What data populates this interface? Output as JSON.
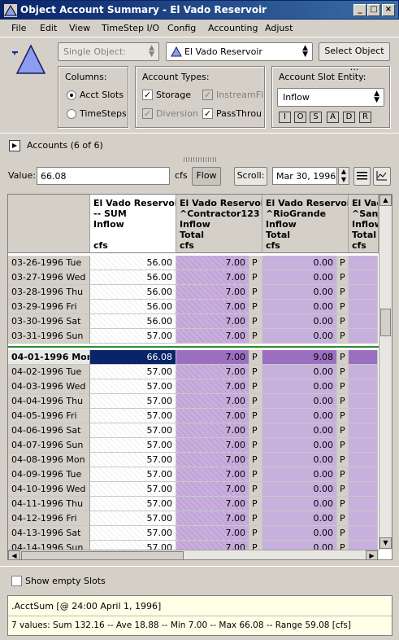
{
  "window": {
    "title": "Object Account Summary - El Vado Reservoir",
    "min": "_",
    "max": "□",
    "close": "×"
  },
  "menu": [
    "File",
    "Edit",
    "View",
    "TimeStep I/O",
    "Config",
    "Accounting",
    "Adjust"
  ],
  "toolbar": {
    "object_mode": "Single Object:",
    "object_name": "El Vado Reservoir",
    "select_object": "Select Object ..."
  },
  "columns_group": {
    "title": "Columns:",
    "options": [
      "Acct Slots",
      "TimeSteps"
    ],
    "selected": "Acct Slots"
  },
  "account_types": {
    "title": "Account Types:",
    "items": [
      {
        "label": "Storage",
        "checked": true,
        "enabled": true
      },
      {
        "label": "InstreamFl",
        "checked": true,
        "enabled": false
      },
      {
        "label": "Diversion",
        "checked": true,
        "enabled": false
      },
      {
        "label": "PassThrou",
        "checked": true,
        "enabled": true
      }
    ]
  },
  "entity": {
    "title": "Account Slot Entity:",
    "value": "Inflow",
    "buttons": [
      "I",
      "O",
      "S",
      "A",
      "D",
      "R"
    ]
  },
  "accounts_header": "Accounts (6 of 6)",
  "value_bar": {
    "label": "Value:",
    "value": "66.08",
    "unit": "cfs",
    "type": "Flow",
    "scroll_label": "Scroll:",
    "date": "Mar 30, 1996"
  },
  "grid": {
    "columns": [
      "El Vado Reservoir\n-- SUM\nInflow\n\ncfs",
      "El Vado Reservoir\n^Contractor123\nInflow\nTotal\ncfs",
      "El Vado Reservoir\n^RioGrande\nInflow\nTotal\ncfs",
      "El Vado Reservoir\n^SanJuan\nInflow\nTotal\ncfs"
    ],
    "rows": [
      {
        "date": "03-26-1996 Tue",
        "sum": "56.00",
        "c1": "7.00",
        "f1": "P",
        "c2": "0.00",
        "f2": "P"
      },
      {
        "date": "03-27-1996 Wed",
        "sum": "56.00",
        "c1": "7.00",
        "f1": "P",
        "c2": "0.00",
        "f2": "P"
      },
      {
        "date": "03-28-1996 Thu",
        "sum": "56.00",
        "c1": "7.00",
        "f1": "P",
        "c2": "0.00",
        "f2": "P"
      },
      {
        "date": "03-29-1996 Fri",
        "sum": "56.00",
        "c1": "7.00",
        "f1": "P",
        "c2": "0.00",
        "f2": "P"
      },
      {
        "date": "03-30-1996 Sat",
        "sum": "56.00",
        "c1": "7.00",
        "f1": "P",
        "c2": "0.00",
        "f2": "P"
      },
      {
        "date": "03-31-1996 Sun",
        "sum": "57.00",
        "c1": "7.00",
        "f1": "P",
        "c2": "0.00",
        "f2": "P"
      },
      {
        "date": "04-01-1996 Mon",
        "sum": "66.08",
        "c1": "7.00",
        "f1": "P",
        "c2": "9.08",
        "f2": "P",
        "current": true
      },
      {
        "date": "04-02-1996 Tue",
        "sum": "57.00",
        "c1": "7.00",
        "f1": "P",
        "c2": "0.00",
        "f2": "P"
      },
      {
        "date": "04-03-1996 Wed",
        "sum": "57.00",
        "c1": "7.00",
        "f1": "P",
        "c2": "0.00",
        "f2": "P"
      },
      {
        "date": "04-04-1996 Thu",
        "sum": "57.00",
        "c1": "7.00",
        "f1": "P",
        "c2": "0.00",
        "f2": "P"
      },
      {
        "date": "04-05-1996 Fri",
        "sum": "57.00",
        "c1": "7.00",
        "f1": "P",
        "c2": "0.00",
        "f2": "P"
      },
      {
        "date": "04-06-1996 Sat",
        "sum": "57.00",
        "c1": "7.00",
        "f1": "P",
        "c2": "0.00",
        "f2": "P"
      },
      {
        "date": "04-07-1996 Sun",
        "sum": "57.00",
        "c1": "7.00",
        "f1": "P",
        "c2": "0.00",
        "f2": "P"
      },
      {
        "date": "04-08-1996 Mon",
        "sum": "57.00",
        "c1": "7.00",
        "f1": "P",
        "c2": "0.00",
        "f2": "P"
      },
      {
        "date": "04-09-1996 Tue",
        "sum": "57.00",
        "c1": "7.00",
        "f1": "P",
        "c2": "0.00",
        "f2": "P"
      },
      {
        "date": "04-10-1996 Wed",
        "sum": "57.00",
        "c1": "7.00",
        "f1": "P",
        "c2": "0.00",
        "f2": "P"
      },
      {
        "date": "04-11-1996 Thu",
        "sum": "57.00",
        "c1": "7.00",
        "f1": "P",
        "c2": "0.00",
        "f2": "P"
      },
      {
        "date": "04-12-1996 Fri",
        "sum": "57.00",
        "c1": "7.00",
        "f1": "P",
        "c2": "0.00",
        "f2": "P"
      },
      {
        "date": "04-13-1996 Sat",
        "sum": "57.00",
        "c1": "7.00",
        "f1": "P",
        "c2": "0.00",
        "f2": "P"
      },
      {
        "date": "04-14-1996 Sun",
        "sum": "57.00",
        "c1": "7.00",
        "f1": "P",
        "c2": "0.00",
        "f2": "P"
      }
    ]
  },
  "show_empty": "Show empty Slots",
  "status": {
    "line1": ".AcctSum [@ 24:00 April 1, 1996]",
    "line2": "7 values:  Sum 132.16 -- Ave 18.88 -- Min 7.00 -- Max 66.08 -- Range 59.08 [cfs]"
  },
  "colors": {
    "title_bar": "#0a246a",
    "account_cell": "#c8b0dd",
    "current_row": "#0a246a",
    "current_line": "#2e8b2e"
  }
}
